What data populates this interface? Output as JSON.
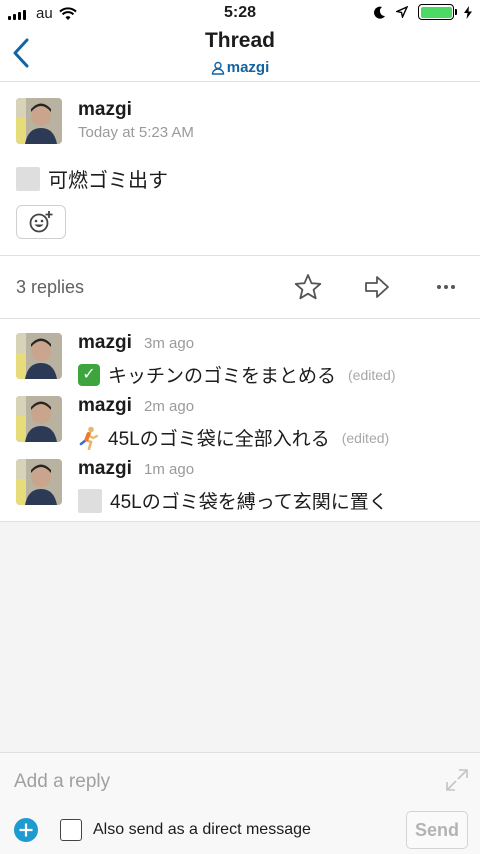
{
  "status_bar": {
    "carrier": "au",
    "time": "5:28",
    "battery_level": 1.0,
    "colors": {
      "battery": "#4cd964"
    }
  },
  "nav": {
    "title": "Thread",
    "channel": "mazgi",
    "accent_color": "#1264a3"
  },
  "parent_message": {
    "author": "mazgi",
    "timestamp": "Today at 5:23 AM",
    "text": "可燃ゴミ出す",
    "emoji_icon": "custom-emoji-icon",
    "reaction_icon": "add-reaction-icon"
  },
  "replies_bar": {
    "count_label": "3 replies",
    "icons": [
      "star-icon",
      "share-arrow-icon",
      "more-icon"
    ]
  },
  "replies": [
    {
      "author": "mazgi",
      "time": "3m ago",
      "text": "キッチンのゴミをまとめる",
      "edited": "(edited)",
      "emoji": "check-mark-icon"
    },
    {
      "author": "mazgi",
      "time": "2m ago",
      "text": "45Lのゴミ袋に全部入れる",
      "edited": "(edited)",
      "emoji": "runner-icon"
    },
    {
      "author": "mazgi",
      "time": "1m ago",
      "text": "45Lのゴミ袋を縛って玄関に置く",
      "edited": "",
      "emoji": "custom-emoji-icon"
    }
  ],
  "composer": {
    "placeholder": "Add a reply",
    "also_send_label": "Also send as a direct message",
    "send_label": "Send",
    "accent_color": "#1d9bd1"
  }
}
